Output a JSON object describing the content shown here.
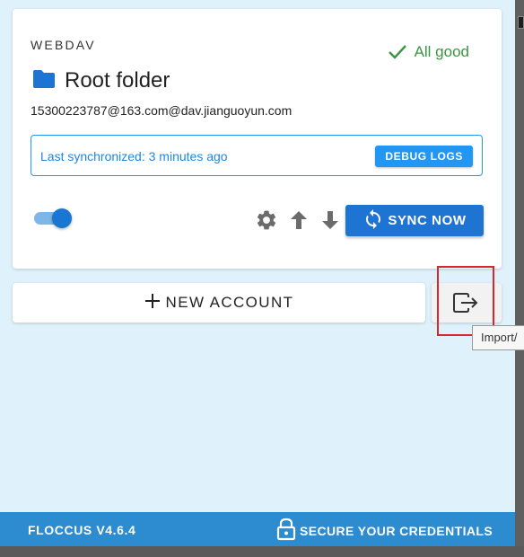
{
  "account": {
    "type_label": "WEBDAV",
    "status": "All good",
    "folder_title": "Root folder",
    "email": "15300223787@163.com@dav.jianguoyun.com",
    "sync_status": "Last synchronized: 3 minutes ago",
    "debug_label": "DEBUG LOGS",
    "sync_label": "SYNC NOW",
    "enabled": true
  },
  "actions": {
    "new_account_label": "NEW ACCOUNT",
    "import_tooltip": "Import/"
  },
  "footer": {
    "version": "FLOCCUS V4.6.4",
    "secure_label": "SECURE YOUR CREDENTIALS"
  },
  "colors": {
    "accent": "#1e74d3",
    "status_ok": "#3b9641",
    "background": "#dff2fc",
    "footer": "#2d8bcf",
    "highlight": "#d9262c"
  },
  "icons": [
    "check-icon",
    "folder-icon",
    "gear-icon",
    "upload-arrow-icon",
    "download-arrow-icon",
    "sync-icon",
    "plus-icon",
    "export-icon",
    "lock-icon"
  ]
}
